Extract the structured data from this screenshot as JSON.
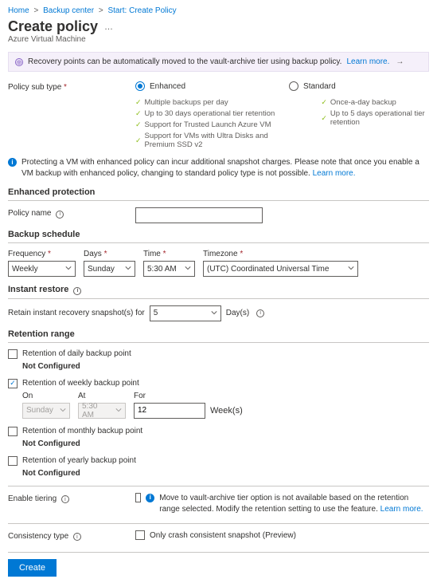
{
  "breadcrumb": {
    "items": [
      "Home",
      "Backup center",
      "Start: Create Policy"
    ]
  },
  "header": {
    "title": "Create policy",
    "subtitle": "Azure Virtual Machine"
  },
  "banner": {
    "text": "Recovery points can be automatically moved to the vault-archive tier using backup policy.",
    "link": "Learn more."
  },
  "policySubType": {
    "label": "Policy sub type",
    "enhanced": {
      "label": "Enhanced",
      "features": [
        "Multiple backups per day",
        "Up to 30 days operational tier retention",
        "Support for Trusted Launch Azure VM",
        "Support for VMs with Ultra Disks and Premium SSD v2"
      ]
    },
    "standard": {
      "label": "Standard",
      "features": [
        "Once-a-day backup",
        "Up to 5 days operational tier retention"
      ]
    }
  },
  "infoNote": {
    "text": "Protecting a VM with enhanced policy can incur additional snapshot charges. Please note that once you enable a VM backup with enhanced policy, changing to standard policy type is not possible.",
    "link": "Learn more."
  },
  "enhancedProtection": {
    "heading": "Enhanced protection",
    "policyNameLabel": "Policy name",
    "policyNameValue": ""
  },
  "backupSchedule": {
    "heading": "Backup schedule",
    "frequencyLabel": "Frequency",
    "frequencyValue": "Weekly",
    "daysLabel": "Days",
    "daysValue": "Sunday",
    "timeLabel": "Time",
    "timeValue": "5:30 AM",
    "timezoneLabel": "Timezone",
    "timezoneValue": "(UTC) Coordinated Universal Time"
  },
  "instantRestore": {
    "heading": "Instant restore",
    "label": "Retain instant recovery snapshot(s) for",
    "value": "5",
    "unit": "Day(s)"
  },
  "retentionRange": {
    "heading": "Retention range",
    "daily": {
      "label": "Retention of daily backup point",
      "status": "Not Configured"
    },
    "weekly": {
      "label": "Retention of weekly backup point",
      "onLabel": "On",
      "onValue": "Sunday",
      "atLabel": "At",
      "atValue": "5:30 AM",
      "forLabel": "For",
      "forValue": "12",
      "forUnit": "Week(s)"
    },
    "monthly": {
      "label": "Retention of monthly backup point",
      "status": "Not Configured"
    },
    "yearly": {
      "label": "Retention of yearly backup point",
      "status": "Not Configured"
    }
  },
  "enableTiering": {
    "label": "Enable tiering",
    "note": "Move to vault-archive tier option is not available based on the retention range selected. Modify the retention setting to use the feature.",
    "link": "Learn more."
  },
  "consistency": {
    "label": "Consistency type",
    "option": "Only crash consistent snapshot (Preview)"
  },
  "footer": {
    "createLabel": "Create"
  }
}
